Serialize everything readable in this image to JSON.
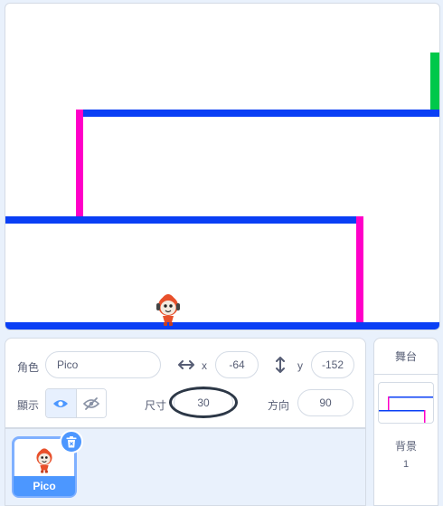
{
  "sprite_info": {
    "sprite_label": "角色",
    "sprite_name": "Pico",
    "x_label": "x",
    "x_value": "-64",
    "y_label": "y",
    "y_value": "-152",
    "show_label": "顯示",
    "size_label": "尺寸",
    "size_value": "30",
    "direction_label": "方向",
    "direction_value": "90"
  },
  "sprite_list": {
    "items": [
      {
        "name": "Pico",
        "selected": true
      }
    ]
  },
  "stage_panel": {
    "title": "舞台",
    "backdrops_label": "背景",
    "backdrops_count": "1"
  },
  "colors": {
    "wall_blue": "#0a3ff5",
    "wall_pink": "#ff00c8",
    "wall_green": "#00c84a",
    "accent": "#4c97ff"
  }
}
